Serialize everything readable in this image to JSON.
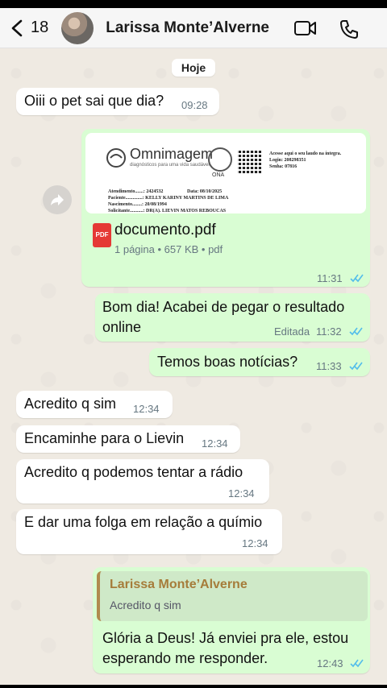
{
  "header": {
    "back_count": "18",
    "contact_name": "Larissa Monte’Alverne",
    "icons": [
      "back-chevron-icon",
      "video-call-icon",
      "phone-call-icon"
    ]
  },
  "day_chip": "Hoje",
  "messages": [
    {
      "direction": "in",
      "text": "Oiii o pet sai que dia?",
      "time": "09:28"
    },
    {
      "direction": "out",
      "type": "document",
      "preview": {
        "brand": "Omnimagem",
        "tagline": "diagnósticos para uma vida saudável",
        "seal": "ONA",
        "access_text": "Acesse aqui o seu laudo na íntegra.",
        "login": "Login: 208298351",
        "senha": "Senha: 07816",
        "atendimento": "Atendimento.......: 2424532",
        "data": "Data: 08/10/2025",
        "paciente": "Paciente..............: KELLY KARINY MARTINS DE LIMA",
        "nascimento": "Nascimento........: 20/08/1994",
        "solicitante": "Solicitante...........: DR(A). LIEVIN MATOS REBOUCAS"
      },
      "file_name": "documento.pdf",
      "file_meta": "1 página • 657 KB • pdf",
      "file_icon_label": "PDF",
      "time": "11:31"
    },
    {
      "direction": "out",
      "text_line1": "Bom dia! Acabei de pegar o resultado",
      "text_line2": "online",
      "edited": "Editada",
      "time": "11:32"
    },
    {
      "direction": "out",
      "text": "Temos boas notícias?",
      "time": "11:33"
    },
    {
      "direction": "in",
      "text": "Acredito q sim",
      "time": "12:34"
    },
    {
      "direction": "in",
      "text": "Encaminhe para o Lievin",
      "time": "12:34"
    },
    {
      "direction": "in",
      "text": "Acredito q podemos tentar a rádio",
      "time": "12:34"
    },
    {
      "direction": "in",
      "text": "E dar uma folga em relação a químio",
      "time": "12:34"
    },
    {
      "direction": "out",
      "quote": {
        "author": "Larissa Monte’Alverne",
        "text": "Acredito q sim"
      },
      "text_line1": "Glória a Deus! Já enviei pra ele, estou",
      "text_line2": "esperando me responder.",
      "time": "12:43"
    }
  ],
  "colors": {
    "chat_bg": "#efeae2",
    "incoming": "#ffffff",
    "outgoing": "#d9fdd3",
    "read_ticks": "#53bdeb",
    "pdf_red": "#e53935",
    "quote_author": "#a67c3a"
  }
}
